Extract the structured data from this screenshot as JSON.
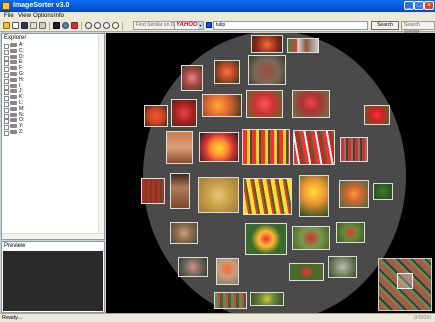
{
  "window": {
    "title": "ImageSorter v3.0"
  },
  "menu": [
    "File",
    "View",
    "Options",
    "Info"
  ],
  "toolbar": {
    "find_similar_on_disk": "Find Similar on Disk",
    "yahoo_logo": "YAHOO!",
    "search_query": "tulip",
    "search_label": "Search",
    "search_similar_label": "Search Similar"
  },
  "explorer": {
    "title": "Explorer",
    "drives": [
      "A:",
      "C:",
      "D:",
      "E:",
      "F:",
      "G:",
      "H:",
      "I:",
      "J:",
      "K:",
      "L:",
      "M:",
      "N:",
      "O:",
      "Y:",
      "Z:"
    ]
  },
  "preview": {
    "title": "Preview"
  },
  "status": {
    "text": "Ready...",
    "counter": "0/0/0/0"
  },
  "colors": {
    "titlebar": "#0a5ce8",
    "stage_bg": "#000000",
    "sphere": "#4a4a4a"
  }
}
